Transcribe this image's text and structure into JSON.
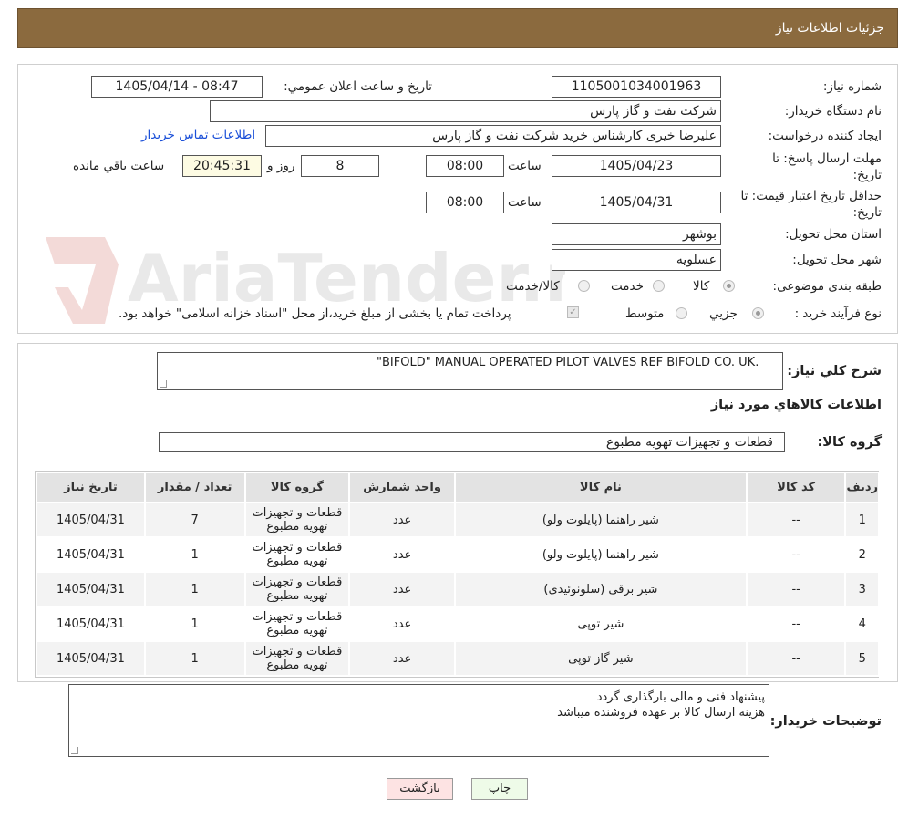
{
  "header": {
    "title": "جزئیات اطلاعات نیاز"
  },
  "info": {
    "need_number_label": "شماره نیاز:",
    "need_number": "1105001034001963",
    "announce_label": "تاریخ و ساعت اعلان عمومي:",
    "announce_value": "1405/04/14 - 08:47",
    "buyer_org_label": "نام دستگاه خریدار:",
    "buyer_org": "شرکت نفت و گاز پارس",
    "creator_label": "ایجاد کننده درخواست:",
    "creator": "علیرضا  خیری کارشناس خرید  شرکت نفت و گاز پارس",
    "contact_link": "اطلاعات تماس خریدار",
    "deadline_label": "مهلت ارسال پاسخ: تا تاریخ:",
    "deadline_date": "1405/04/23",
    "time_label": "ساعت",
    "deadline_time": "08:00",
    "days_value": "8",
    "days_label": "روز و",
    "remaining_time": "20:45:31",
    "remaining_label": "ساعت باقي مانده",
    "validity_label": "حداقل تاریخ اعتبار قیمت: تا تاریخ:",
    "validity_date": "1405/04/31",
    "validity_time": "08:00",
    "province_label": "استان محل تحویل:",
    "province": "بوشهر",
    "city_label": "شهر محل تحویل:",
    "city": "عسلویه",
    "category_label": "طبقه بندی موضوعی:",
    "category_options": [
      "کالا",
      "خدمت",
      "کالا/خدمت"
    ],
    "category_selected": "کالا",
    "process_label": "نوع فرآیند خرید :",
    "process_options": [
      "جزیي",
      "متوسط"
    ],
    "process_selected": "جزیي",
    "payment_note": "پرداخت تمام یا بخشی از مبلغ خرید،از محل \"اسناد خزانه اسلامی\" خواهد بود."
  },
  "description": {
    "label": "شرح کلي نیاز:",
    "value": "\"BIFOLD\" MANUAL OPERATED PILOT VALVES REF BIFOLD CO. UK."
  },
  "goods": {
    "section_title": "اطلاعات کالاهاي مورد نیاز",
    "group_label": "گروه کالا:",
    "group_value": "قطعات و تجهیزات تهویه مطبوع",
    "columns": [
      "ردیف",
      "کد کالا",
      "نام کالا",
      "واحد شمارش",
      "گروه کالا",
      "تعداد / مقدار",
      "تاریخ نیاز"
    ],
    "rows": [
      {
        "row": "1",
        "code": "--",
        "name": "شیر راهنما (پایلوت ولو)",
        "unit": "عدد",
        "group": "قطعات و تجهیزات تهویه مطبوع",
        "qty": "7",
        "date": "1405/04/31"
      },
      {
        "row": "2",
        "code": "--",
        "name": "شیر راهنما (پایلوت ولو)",
        "unit": "عدد",
        "group": "قطعات و تجهیزات تهویه مطبوع",
        "qty": "1",
        "date": "1405/04/31"
      },
      {
        "row": "3",
        "code": "--",
        "name": "شیر برقی (سلونوئیدی)",
        "unit": "عدد",
        "group": "قطعات و تجهیزات تهویه مطبوع",
        "qty": "1",
        "date": "1405/04/31"
      },
      {
        "row": "4",
        "code": "--",
        "name": "شیر توپی",
        "unit": "عدد",
        "group": "قطعات و تجهیزات تهویه مطبوع",
        "qty": "1",
        "date": "1405/04/31"
      },
      {
        "row": "5",
        "code": "--",
        "name": "شیر گاز توپی",
        "unit": "عدد",
        "group": "قطعات و تجهیزات تهویه مطبوع",
        "qty": "1",
        "date": "1405/04/31"
      }
    ]
  },
  "buyer_notes": {
    "label": "توضیحات خریدار:",
    "line1": "پیشنهاد فنی و مالی بارگذاری گردد",
    "line2": "هزینه ارسال کالا بر عهده فروشنده میباشد"
  },
  "buttons": {
    "print": "چاپ",
    "back": "بازگشت"
  },
  "watermark": {
    "text": "AriaTender.neT"
  },
  "colors": {
    "header_bg": "#8b6a3e",
    "link": "#1a4fd8",
    "back_button": "#fde3e3",
    "print_button": "#eefbe8"
  }
}
